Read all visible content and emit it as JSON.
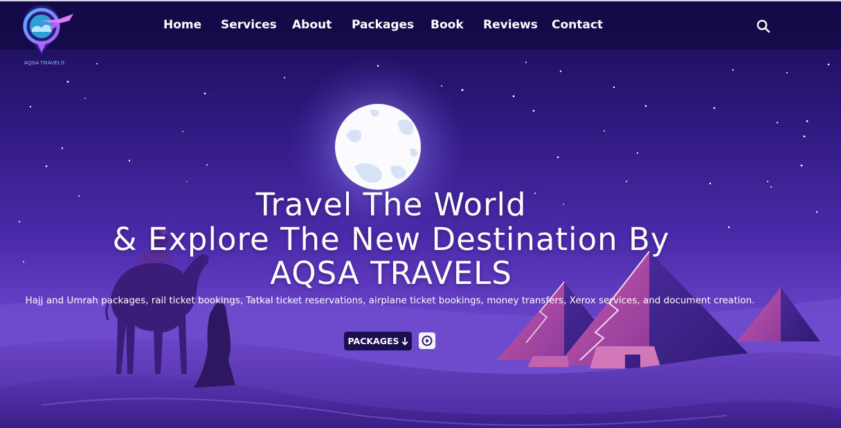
{
  "brand": {
    "name": "AQSA TRAVELS"
  },
  "nav": {
    "items": [
      {
        "label": "Home"
      },
      {
        "label": "Services"
      },
      {
        "label": "About"
      },
      {
        "label": "Packages"
      },
      {
        "label": "Book"
      },
      {
        "label": "Reviews"
      },
      {
        "label": "Contact"
      }
    ],
    "search_icon": "search-icon"
  },
  "hero": {
    "title_line1": "Travel The World",
    "title_line2": "& Explore The New Destination By",
    "title_line3": "AQSA TRAVELS",
    "description": "Hajj and Umrah packages, rail ticket bookings, Tatkal ticket reservations, airplane ticket bookings, money transfers, Xerox services, and document creation.",
    "packages_button": "PACKAGES",
    "packages_icon": "arrow-down-icon",
    "play_icon": "play-icon"
  },
  "colors": {
    "navbar": "#170c4f",
    "sky_top": "#1c0f5c",
    "sky_bottom": "#7c55d2",
    "button": "#1b0f52",
    "pyramid": "#b04fa8",
    "moon": "#ffffff"
  }
}
